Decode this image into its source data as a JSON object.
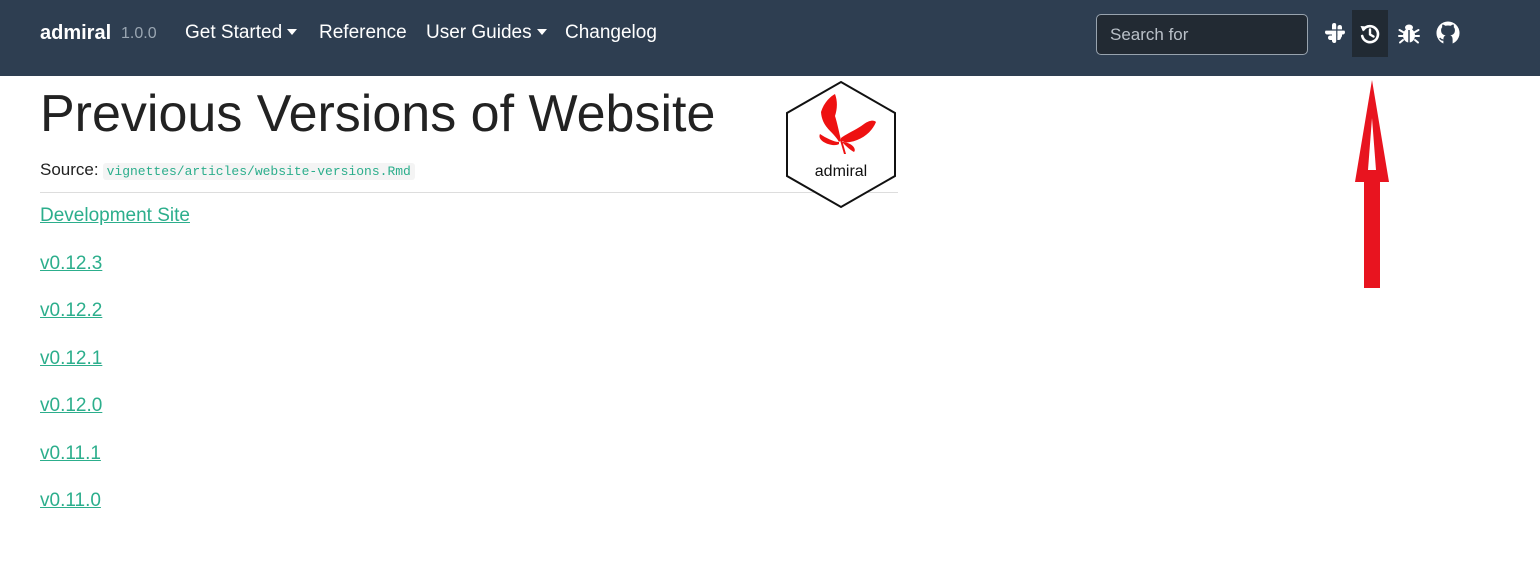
{
  "navbar": {
    "brand": "admiral",
    "version": "1.0.0",
    "items": [
      {
        "label": "Get Started"
      },
      {
        "label": "Reference"
      },
      {
        "label": "User Guides"
      },
      {
        "label": "Changelog"
      }
    ],
    "search_placeholder": "Search for",
    "icons": [
      "slack-icon",
      "history-icon",
      "bug-icon",
      "github-icon"
    ],
    "background_color": "#2e3e51"
  },
  "page": {
    "title": "Previous Versions of Website",
    "source_label": "Source:",
    "source_path": "vignettes/articles/website-versions.Rmd",
    "logo_text": "admiral",
    "links": [
      "Development Site",
      "v0.12.3",
      "v0.12.2",
      "v0.12.1",
      "v0.12.0",
      "v0.11.1",
      "v0.11.0"
    ],
    "link_color": "#2cae8c"
  },
  "annotation": {
    "arrow_color": "#e8141f"
  }
}
